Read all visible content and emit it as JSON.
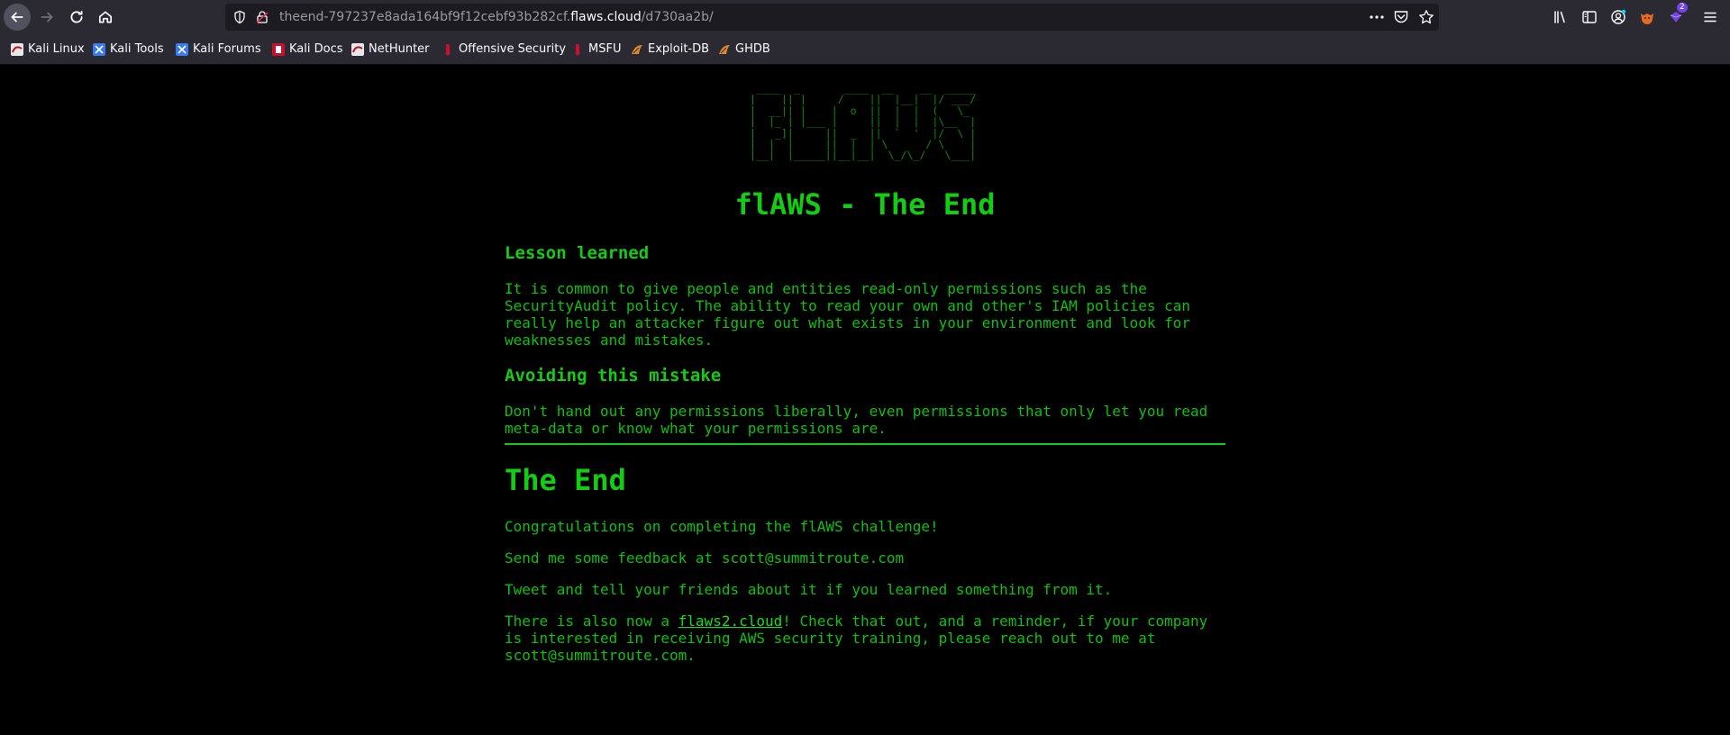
{
  "browser": {
    "url_prefix": "theend-797237e8ada164bf9f12cebf93b282cf.",
    "url_domain": "flaws.cloud",
    "url_path": "/d730aa2b/",
    "extension_badge": "2"
  },
  "bookmarks": [
    {
      "label": "Kali Linux",
      "icon": "kali-icon"
    },
    {
      "label": "Kali Tools",
      "icon": "kali-tools-icon"
    },
    {
      "label": "Kali Forums",
      "icon": "kali-forums-icon"
    },
    {
      "label": "Kali Docs",
      "icon": "kali-docs-icon"
    },
    {
      "label": "NetHunter",
      "icon": "nethunter-icon"
    },
    {
      "label": "Offensive Security",
      "icon": "offsec-icon"
    },
    {
      "label": "MSFU",
      "icon": "msfu-icon"
    },
    {
      "label": "Exploit-DB",
      "icon": "exploitdb-icon"
    },
    {
      "label": "GHDB",
      "icon": "ghdb-icon"
    }
  ],
  "page": {
    "ascii_logo": "  ____  _       ____  __    __  _____ \n |    || |     /    ||  |__|  |/ ___/\n |  __|| |    |  o  ||  |  |  (   \\_ \n |  |_ | |___ |     ||  |  |  |\\__  |\n |   _]|     ||  _  ||  `  '  |/  \\ |\n |  |  |     ||  |  | \\      / \\    |\n |__|  |_____||__|__|  \\_/\\_/   \\___|",
    "title": "flAWS - The End",
    "lesson_heading": "Lesson learned",
    "lesson_text": "It is common to give people and entities read-only permissions such as the\nSecurityAudit policy. The ability to read your own and other's IAM policies can\nreally help an attacker figure out what exists in your environment and look for\nweaknesses and mistakes.",
    "avoid_heading": "Avoiding this mistake",
    "avoid_text": "Don't hand out any permissions liberally, even permissions that only let you read\nmeta-data or know what your permissions are.",
    "end_heading": "The End",
    "congrats": "Congratulations on completing the flAWS challenge!",
    "feedback": "Send me some feedback at scott@summitroute.com",
    "tweet": "Tweet and tell your friends about it if you learned something from it.",
    "also_prefix": "There is also now a ",
    "also_link": "flaws2.cloud",
    "also_suffix": "! Check that out, and a reminder, if your company\nis interested in receiving AWS security training, please reach out to me at\nscott@summitroute.com."
  }
}
